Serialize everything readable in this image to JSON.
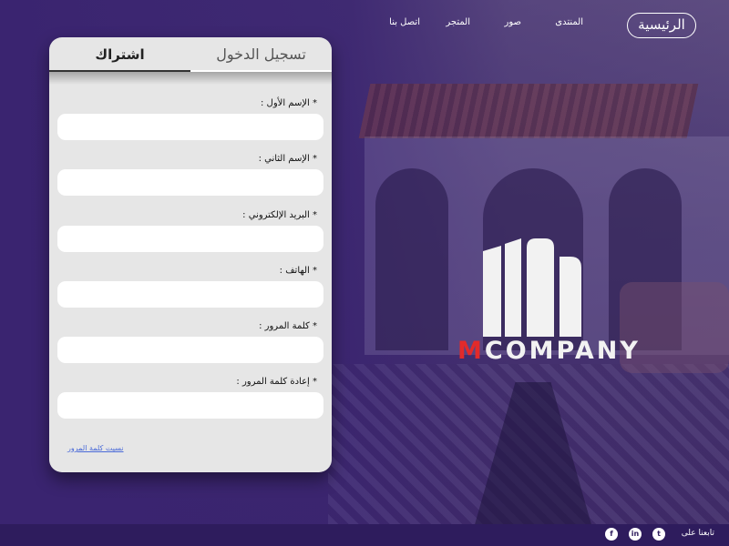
{
  "nav": {
    "home": "الرئيسية",
    "links": [
      "المنتدى",
      "صور",
      "المتجر",
      "اتصل بنا"
    ]
  },
  "form": {
    "tab_login": "تسجيل الدخول",
    "tab_signup": "اشتراك",
    "fields": [
      {
        "label": "* الإسم الأول :"
      },
      {
        "label": "* الإسم الثاني :"
      },
      {
        "label": "* البريد الإلكتروني :"
      },
      {
        "label": "* الهاتف :"
      },
      {
        "label": "* كلمة المرور :"
      },
      {
        "label": "* إعادة كلمة المرور :"
      }
    ],
    "forgot": "نسيت كلمة المرور"
  },
  "logo": {
    "letter": "M",
    "rest": "COMPANY"
  },
  "footer": {
    "follow": "تابعنا على",
    "social": [
      {
        "icon": "twitter-icon",
        "glyph": "t"
      },
      {
        "icon": "linkedin-icon",
        "glyph": "in"
      },
      {
        "icon": "facebook-icon",
        "glyph": "f"
      }
    ]
  },
  "colors": {
    "background": "#3a2470",
    "footer": "#2e1c5d",
    "accent_red": "#e32a2a",
    "card": "#e6e6e6",
    "link": "#4a6ad8"
  }
}
